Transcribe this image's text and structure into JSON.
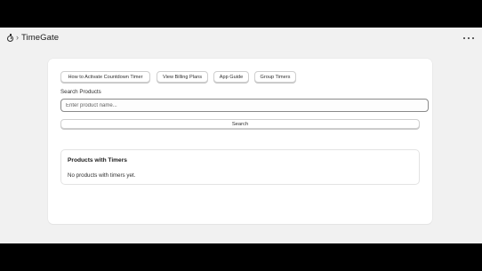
{
  "app": {
    "title": "TimeGate",
    "icon": "stopwatch-icon",
    "breadcrumb_separator": "›",
    "more_icon": "more-horizontal-icon"
  },
  "actions": {
    "activate_label": "How to Activate Countdown Timer",
    "billing_label": "View Billing Plans",
    "guide_label": "App Guide",
    "groups_label": "Group Timers"
  },
  "search": {
    "label": "Search Products",
    "placeholder": "Enter product name...",
    "value": "",
    "button_label": "Search"
  },
  "products": {
    "title": "Products with Timers",
    "empty_text": "No products with timers yet."
  },
  "colors": {
    "background": "#f1f1f1",
    "card": "#ffffff",
    "text": "#303030",
    "letterbox": "#000000"
  }
}
